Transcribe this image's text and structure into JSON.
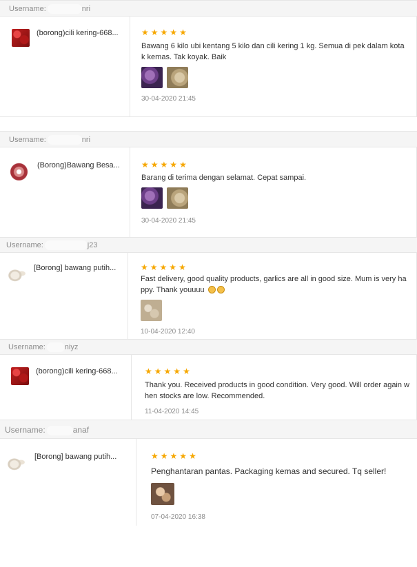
{
  "colors": {
    "star": "#f6a700",
    "header_bg": "#f5f5f5",
    "border": "#e6e6e6",
    "muted": "#8c8c8c"
  },
  "reviews": [
    {
      "username_label": "Username:",
      "username_suffix": "nri",
      "product_name": "(borong)cili kering-668...",
      "product_icon": "dried-chili",
      "stars": 5,
      "text": "Bawang 6 kilo ubi kentang 5 kilo dan cili kering 1 kg. Semua di pek dalam kota k kemas. Tak koyak. Baik",
      "date": "30-04-2020 21:45"
    },
    {
      "username_label": "Username:",
      "username_suffix": "nri",
      "product_name": "(Borong)Bawang Besa...",
      "product_icon": "red-onion",
      "stars": 5,
      "text": "Barang di terima dengan selamat. Cepat sampai.",
      "date": "30-04-2020 21:45"
    },
    {
      "username_label": "Username:",
      "username_suffix": "j23",
      "product_name": "[Borong] bawang putih...",
      "product_icon": "garlic",
      "stars": 5,
      "text": "Fast delivery, good quality products, garlics are all in good size. Mum is very ha ppy. Thank youuuu",
      "emoji": "smile-emoji",
      "date": "10-04-2020 12:40"
    },
    {
      "username_label": "Username:",
      "username_suffix": "niyz",
      "product_name": "(borong)cili kering-668...",
      "product_icon": "dried-chili",
      "stars": 5,
      "text": "Thank you. Received products in good condition. Very good. Will order again w hen stocks are low. Recommended.",
      "date": "11-04-2020 14:45"
    },
    {
      "username_label": "Username:",
      "username_suffix": "anaf",
      "product_name": "[Borong] bawang putih...",
      "product_icon": "garlic",
      "stars": 5,
      "text": "Penghantaran pantas. Packaging kemas and secured. Tq seller!",
      "date": "07-04-2020 16:38"
    }
  ]
}
